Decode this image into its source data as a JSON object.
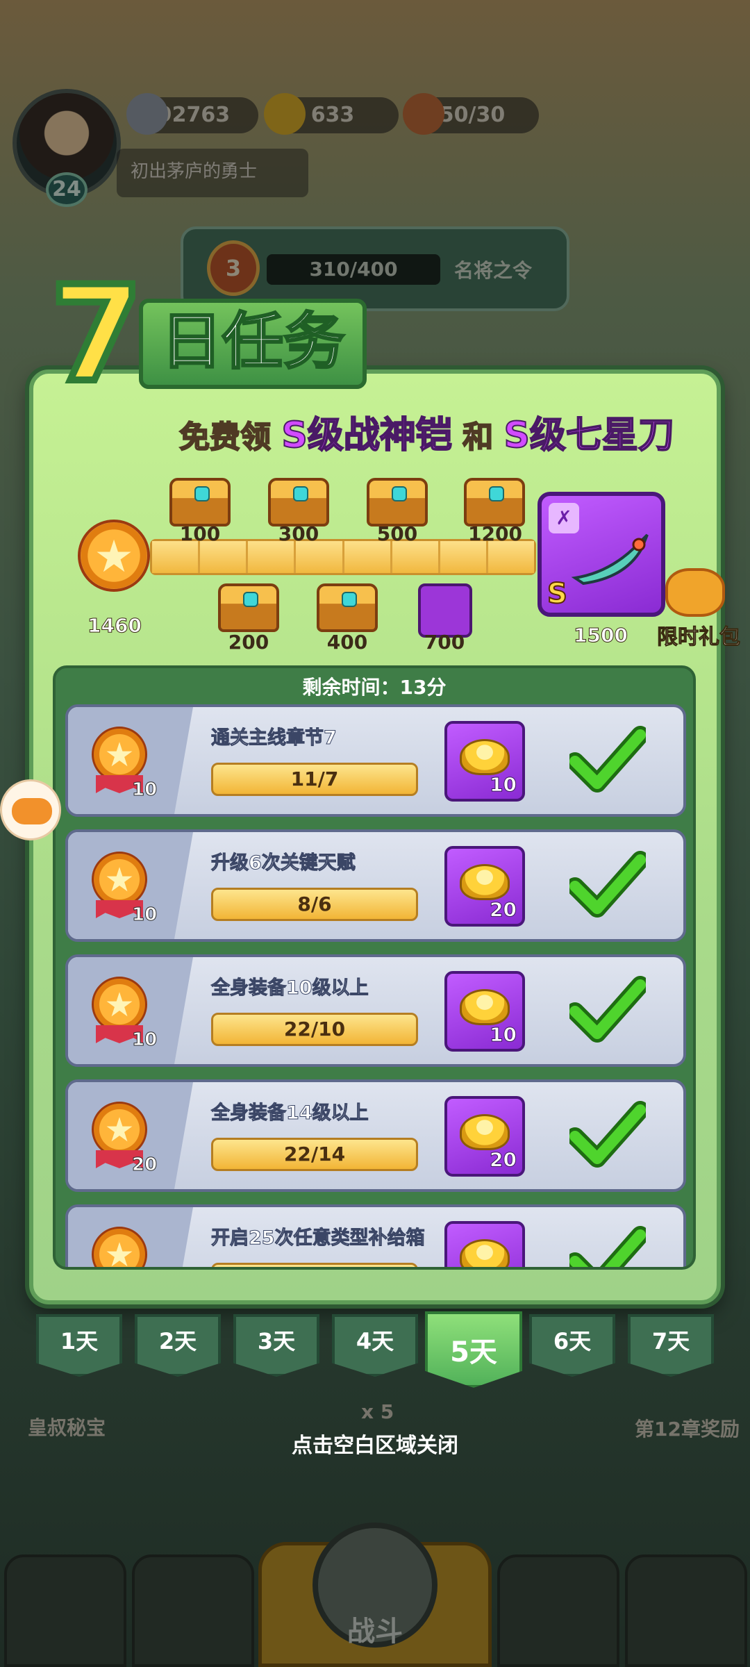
{
  "hud": {
    "level": "24",
    "player_title": "初出茅庐的勇士",
    "silver": "92763",
    "gold": "633",
    "stamina": "50/30",
    "rank_number": "3",
    "rank_progress": "310/400",
    "rank_label": "名将之令"
  },
  "panel": {
    "title_number": "7",
    "title_text": "日任务",
    "promo": {
      "part1": "免费领",
      "item1": "S级战神铠",
      "and": "和",
      "item2": "S级七星刀"
    },
    "total_points": "1460",
    "milestones_top": [
      "100",
      "300",
      "500",
      "1200"
    ],
    "milestones_bottom": [
      "200",
      "400",
      "700"
    ],
    "final_reward_points": "1500",
    "final_reward_grade": "S",
    "gift_label": "限时礼包",
    "remaining_time": "剩余时间：13分"
  },
  "tasks": [
    {
      "name": "通关主线章节7",
      "points": "10",
      "progress": "11/7",
      "reward_amount": "10",
      "completed": true
    },
    {
      "name": "升级6次关键天赋",
      "points": "10",
      "progress": "8/6",
      "reward_amount": "20",
      "completed": true
    },
    {
      "name": "全身装备10级以上",
      "points": "10",
      "progress": "22/10",
      "reward_amount": "10",
      "completed": true
    },
    {
      "name": "全身装备14级以上",
      "points": "20",
      "progress": "22/14",
      "reward_amount": "20",
      "completed": true
    },
    {
      "name": "开启25次任意类型补给箱",
      "points": "",
      "progress": "",
      "reward_amount": "",
      "completed": true
    }
  ],
  "day_tabs": [
    "1天",
    "2天",
    "3天",
    "4天",
    "5天",
    "6天",
    "7天"
  ],
  "active_day": "5天",
  "close_hint": "点击空白区域关闭",
  "background": {
    "left_label": "皇叔秘宝",
    "right_label": "第12章奖励",
    "battle_label": "战斗",
    "battle_cost": "x 5"
  }
}
